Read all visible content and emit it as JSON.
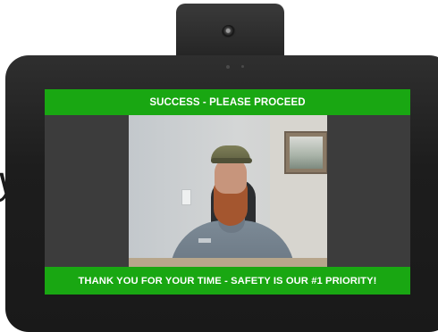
{
  "kiosk": {
    "status_banner": "SUCCESS - PLEASE PROCEED",
    "footer_banner": "THANK YOU FOR YOUR TIME - SAFETY IS OUR #1 PRIORITY!",
    "edge_text": "y"
  },
  "colors": {
    "banner_green": "#19a712",
    "banner_text": "#ffffff",
    "device_body": "#1d1d1d",
    "screen_background": "#3c3c3c"
  },
  "camera_feed": {
    "subject": "person-in-cap-and-grey-uniform"
  }
}
